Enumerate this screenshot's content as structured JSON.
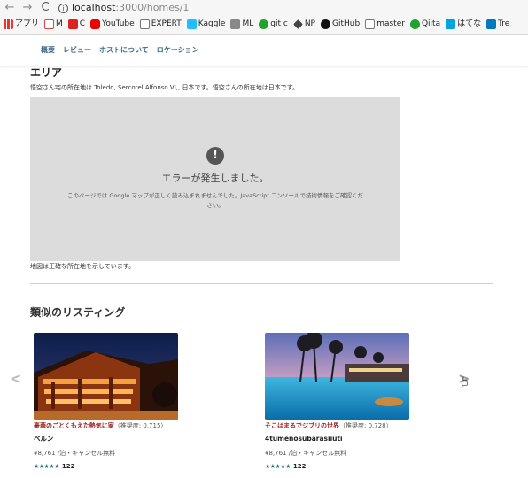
{
  "browser": {
    "nav": [
      "←",
      "→",
      "C"
    ],
    "url_host": "localhost",
    "url_path": ":3000/homes/1",
    "bookmarks": [
      {
        "label": "アプリ",
        "icon": "apps-icon"
      },
      {
        "label": "M",
        "icon": "gmail-icon"
      },
      {
        "label": "C",
        "icon": "c-icon"
      },
      {
        "label": "YouTube",
        "icon": "youtube-icon"
      },
      {
        "label": "EXPERT",
        "icon": "doc-icon"
      },
      {
        "label": "Kaggle",
        "icon": "kaggle-icon"
      },
      {
        "label": "ML",
        "icon": "folder-icon"
      },
      {
        "label": "git c",
        "icon": "greenface-icon"
      },
      {
        "label": "NP",
        "icon": "np-icon"
      },
      {
        "label": "GitHub",
        "icon": "github-icon"
      },
      {
        "label": "master",
        "icon": "doc-icon"
      },
      {
        "label": "Qiita",
        "icon": "greenface-icon"
      },
      {
        "label": "はてな",
        "icon": "hatena-icon"
      },
      {
        "label": "Tre",
        "icon": "trello-icon"
      }
    ]
  },
  "subnav": [
    "概要",
    "レビュー",
    "ホストについて",
    "ロケーション"
  ],
  "area": {
    "title": "エリア",
    "description": "悟空さん宅の所在地は Toledo, Sercotel Alfonso VI,, 日本です。悟空さんの所在地は日本です。",
    "map_error_icon": "!",
    "map_error_title": "エラーが発生しました。",
    "map_error_desc": "このページでは Google マップが正しく読み込まれませんでした。JavaScript コンソールで技術情報をご確認ください。",
    "map_caption": "地図は正確な所在地を示しています。"
  },
  "similar": {
    "title": "類似のリスティング",
    "prev": "<",
    "next": ">",
    "cards": [
      {
        "highlight": "豪華のごとくもえた熱気に家",
        "recommend": "（推奨度: 0.715）",
        "name": "ベルン",
        "price": "¥8,761 /泊・キャンセル無料",
        "stars": "★★★★★",
        "reviews": "122"
      },
      {
        "highlight": "そこはまるでジブリの世界",
        "recommend": "（推奨度: 0.728）",
        "name": "4tumenosubarasiiuti",
        "price": "¥8,761 /泊・キャンセル無料",
        "stars": "★★★★★",
        "reviews": "122"
      }
    ]
  },
  "colors": {
    "subnav_link": "#3d6b84",
    "highlight": "#9c2424",
    "stars": "#1f6e79",
    "map_bg": "#dcdcdc"
  }
}
